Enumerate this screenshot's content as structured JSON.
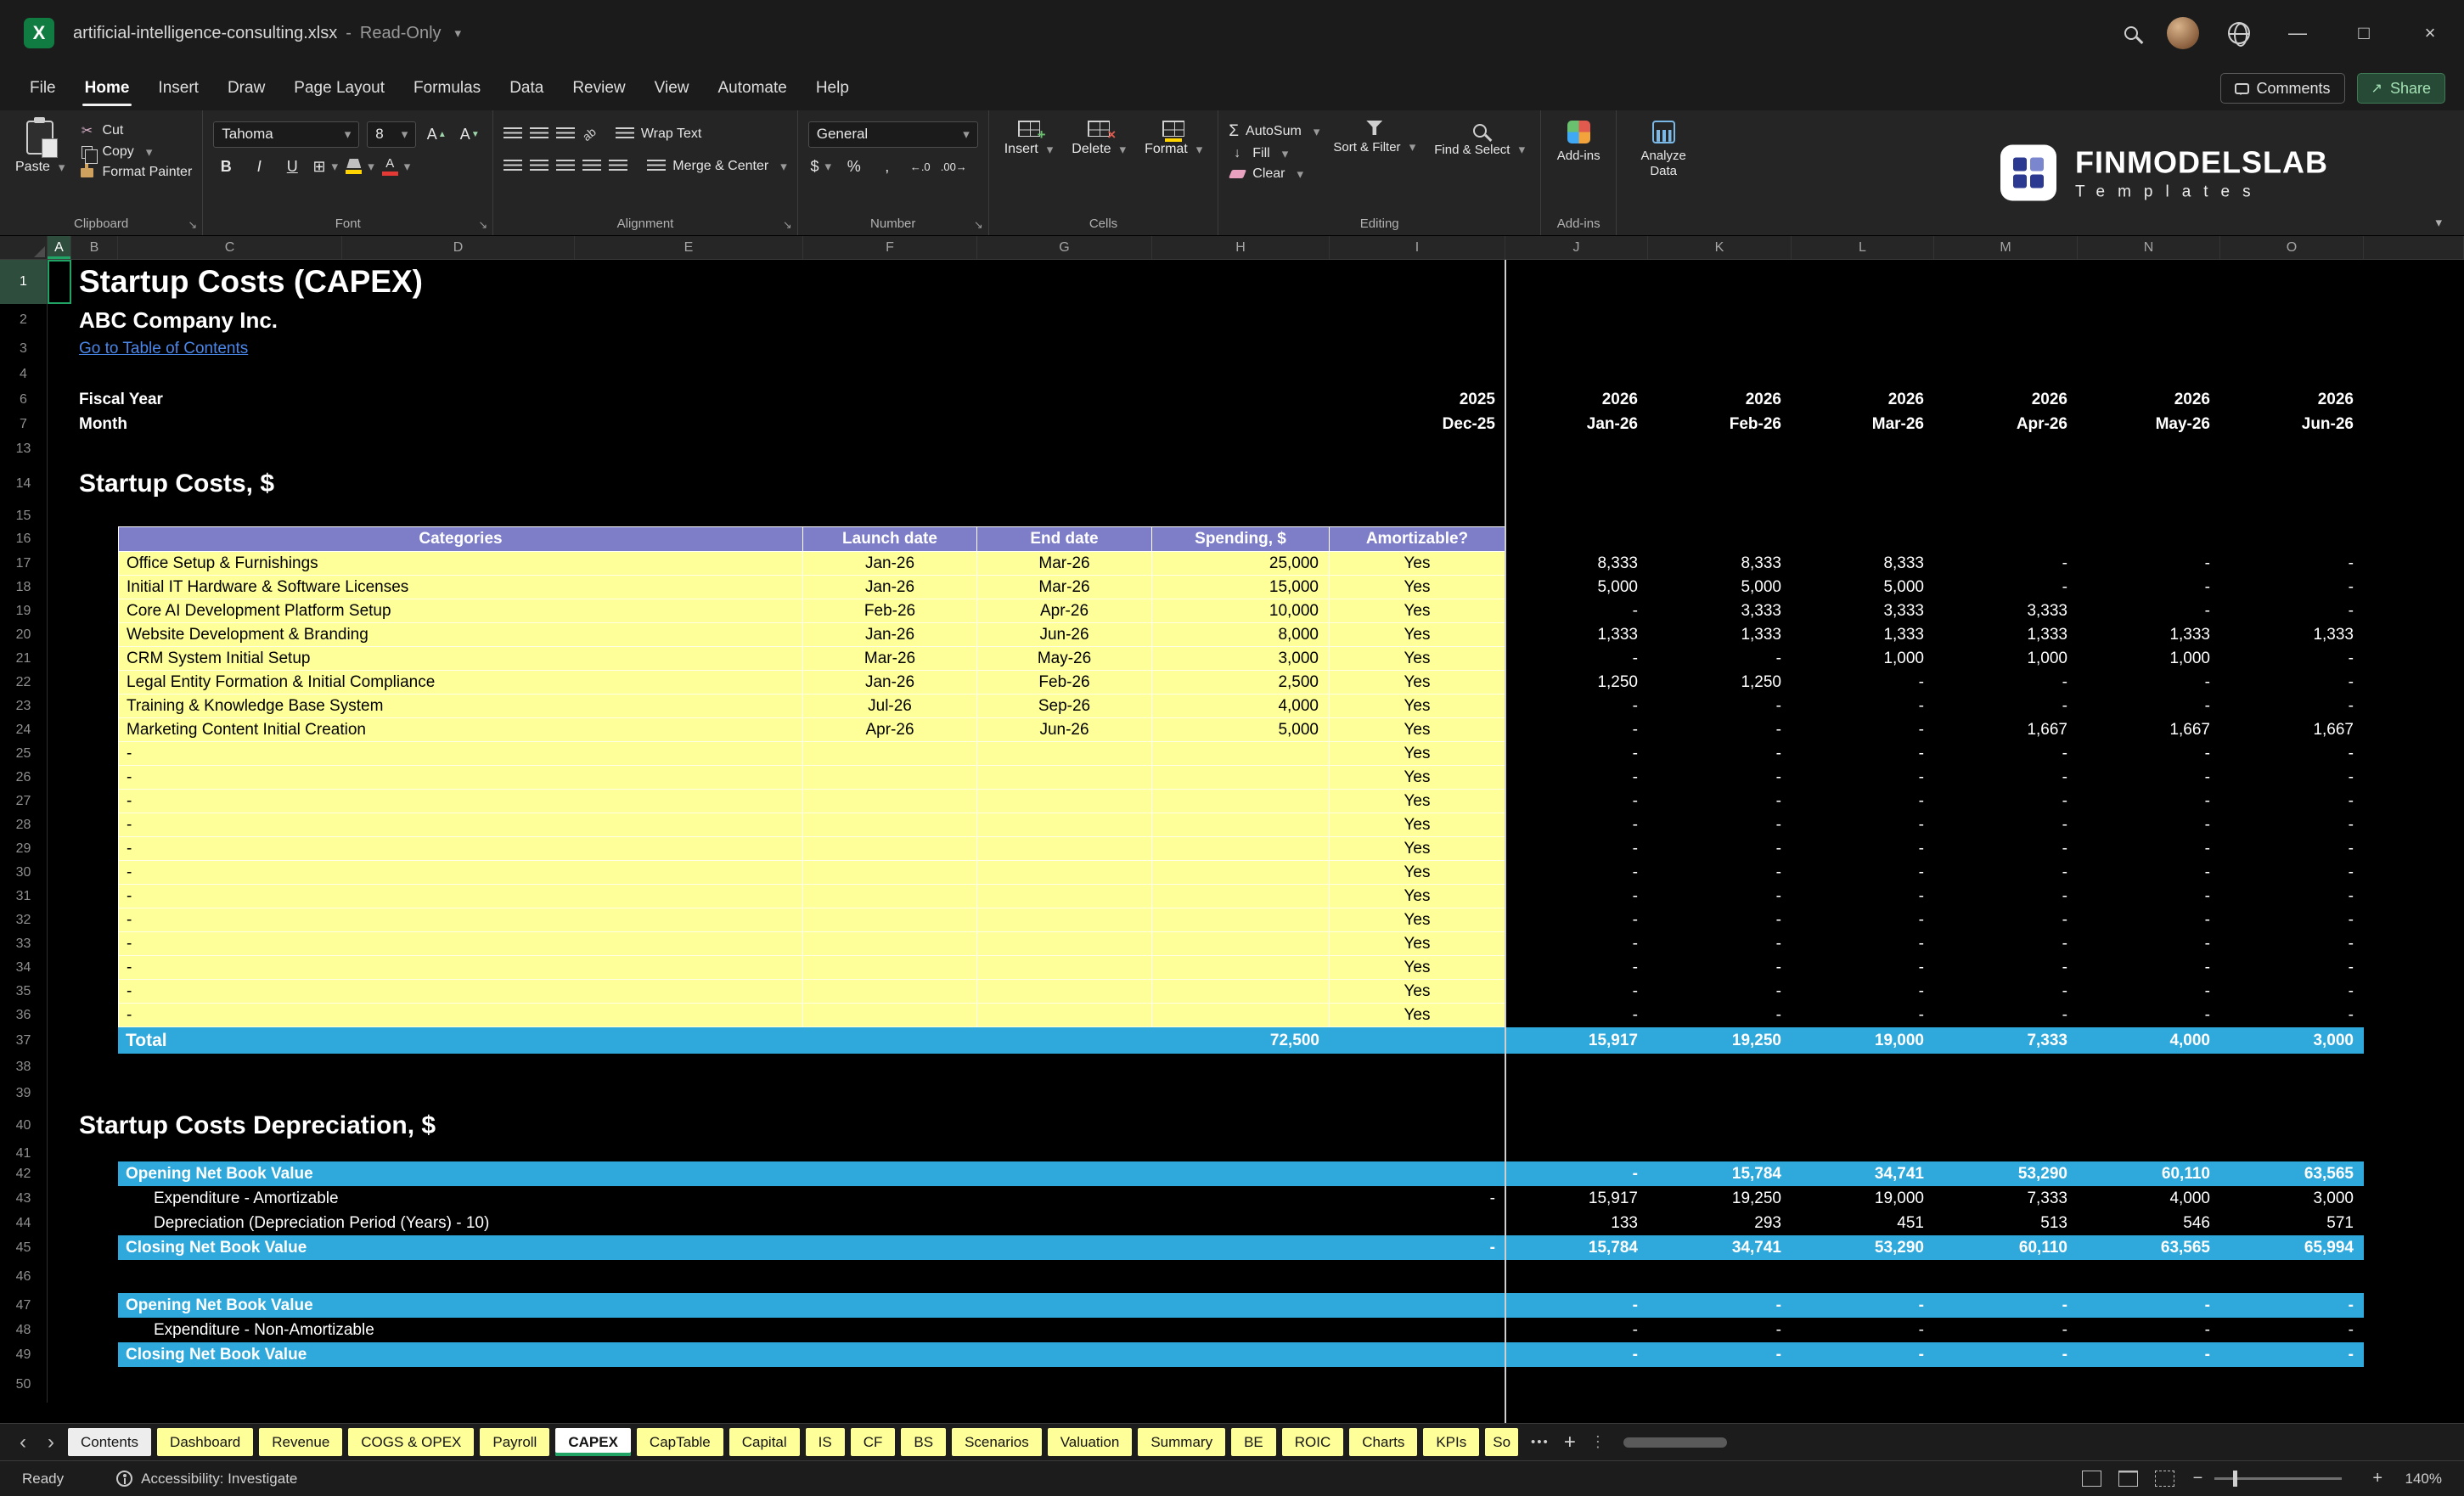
{
  "window": {
    "file_name": "artificial-intelligence-consulting.xlsx",
    "separator": "-",
    "mode": "Read-Only"
  },
  "menu": {
    "items": [
      "File",
      "Home",
      "Insert",
      "Draw",
      "Page Layout",
      "Formulas",
      "Data",
      "Review",
      "View",
      "Automate",
      "Help"
    ],
    "active": "Home",
    "comments": "Comments",
    "share": "Share"
  },
  "ribbon": {
    "clipboard": {
      "label": "Clipboard",
      "paste": "Paste",
      "cut": "Cut",
      "copy": "Copy",
      "format_painter": "Format Painter"
    },
    "font": {
      "label": "Font",
      "font_name": "Tahoma",
      "font_size": "8",
      "bold": "B",
      "italic": "I",
      "underline": "U"
    },
    "alignment": {
      "label": "Alignment",
      "wrap_text": "Wrap Text",
      "merge_center": "Merge & Center"
    },
    "number": {
      "label": "Number",
      "format": "General",
      "currency": "$",
      "percent": "%",
      "comma": ","
    },
    "cells": {
      "label": "Cells",
      "insert": "Insert",
      "delete": "Delete",
      "format": "Format"
    },
    "editing": {
      "label": "Editing",
      "autosum": "AutoSum",
      "fill": "Fill",
      "clear": "Clear",
      "sort_filter": "Sort & Filter",
      "find_select": "Find & Select"
    },
    "addins": {
      "label": "Add-ins",
      "button": "Add-ins",
      "analyze": "Analyze Data"
    }
  },
  "brand": {
    "name": "FINMODELSLAB",
    "tagline": "Templates"
  },
  "colors": {
    "input_yellow": "#FFFF99",
    "header_purple": "#7D7DC8",
    "band_blue": "#2FA8DC",
    "active_green": "#21A366",
    "link_blue": "#4A86E8"
  },
  "sheet": {
    "columns": [
      "A",
      "B",
      "C",
      "D",
      "E",
      "F",
      "G",
      "H",
      "I",
      "J",
      "K",
      "L",
      "M",
      "N",
      "O"
    ],
    "row_numbers": [
      1,
      2,
      3,
      4,
      6,
      7,
      13,
      14,
      15,
      16,
      17,
      18,
      19,
      20,
      21,
      22,
      23,
      24,
      25,
      26,
      27,
      28,
      29,
      30,
      31,
      32,
      33,
      34,
      35,
      36,
      37,
      38,
      39,
      40,
      41,
      42,
      43,
      44,
      45,
      46,
      47,
      48,
      49,
      50
    ],
    "title": "Startup Costs (CAPEX)",
    "company": "ABC Company Inc.",
    "toc_link": "Go to Table of Contents",
    "fiscal_year_label": "Fiscal Year",
    "fiscal_year_first": "2025",
    "fiscal_years": [
      "2026",
      "2026",
      "2026",
      "2026",
      "2026",
      "2026"
    ],
    "month_label": "Month",
    "month_first": "Dec-25",
    "months": [
      "Jan-26",
      "Feb-26",
      "Mar-26",
      "Apr-26",
      "May-26",
      "Jun-26"
    ],
    "section_costs": "Startup Costs, $",
    "section_depreciation": "Startup Costs Depreciation, $",
    "table": {
      "headers": [
        "Categories",
        "Launch date",
        "End date",
        "Spending, $",
        "Amortizable?"
      ],
      "rows": [
        {
          "category": "Office Setup & Furnishings",
          "launch": "Jan-26",
          "end": "Mar-26",
          "spending": "25,000",
          "amortizable": "Yes",
          "values": [
            "8,333",
            "8,333",
            "8,333",
            "-",
            "-",
            "-"
          ]
        },
        {
          "category": "Initial IT Hardware & Software Licenses",
          "launch": "Jan-26",
          "end": "Mar-26",
          "spending": "15,000",
          "amortizable": "Yes",
          "values": [
            "5,000",
            "5,000",
            "5,000",
            "-",
            "-",
            "-"
          ]
        },
        {
          "category": "Core AI Development Platform Setup",
          "launch": "Feb-26",
          "end": "Apr-26",
          "spending": "10,000",
          "amortizable": "Yes",
          "values": [
            "-",
            "3,333",
            "3,333",
            "3,333",
            "-",
            "-"
          ]
        },
        {
          "category": "Website Development & Branding",
          "launch": "Jan-26",
          "end": "Jun-26",
          "spending": "8,000",
          "amortizable": "Yes",
          "values": [
            "1,333",
            "1,333",
            "1,333",
            "1,333",
            "1,333",
            "1,333"
          ]
        },
        {
          "category": "CRM System Initial Setup",
          "launch": "Mar-26",
          "end": "May-26",
          "spending": "3,000",
          "amortizable": "Yes",
          "values": [
            "-",
            "-",
            "1,000",
            "1,000",
            "1,000",
            "-"
          ]
        },
        {
          "category": "Legal Entity Formation & Initial Compliance",
          "launch": "Jan-26",
          "end": "Feb-26",
          "spending": "2,500",
          "amortizable": "Yes",
          "values": [
            "1,250",
            "1,250",
            "-",
            "-",
            "-",
            "-"
          ]
        },
        {
          "category": "Training & Knowledge Base System",
          "launch": "Jul-26",
          "end": "Sep-26",
          "spending": "4,000",
          "amortizable": "Yes",
          "values": [
            "-",
            "-",
            "-",
            "-",
            "-",
            "-"
          ]
        },
        {
          "category": "Marketing Content Initial Creation",
          "launch": "Apr-26",
          "end": "Jun-26",
          "spending": "5,000",
          "amortizable": "Yes",
          "values": [
            "-",
            "-",
            "-",
            "1,667",
            "1,667",
            "1,667"
          ]
        },
        {
          "category": "-",
          "launch": "",
          "end": "",
          "spending": "",
          "amortizable": "Yes",
          "values": [
            "-",
            "-",
            "-",
            "-",
            "-",
            "-"
          ]
        },
        {
          "category": "-",
          "launch": "",
          "end": "",
          "spending": "",
          "amortizable": "Yes",
          "values": [
            "-",
            "-",
            "-",
            "-",
            "-",
            "-"
          ]
        },
        {
          "category": "-",
          "launch": "",
          "end": "",
          "spending": "",
          "amortizable": "Yes",
          "values": [
            "-",
            "-",
            "-",
            "-",
            "-",
            "-"
          ]
        },
        {
          "category": "-",
          "launch": "",
          "end": "",
          "spending": "",
          "amortizable": "Yes",
          "values": [
            "-",
            "-",
            "-",
            "-",
            "-",
            "-"
          ]
        },
        {
          "category": "-",
          "launch": "",
          "end": "",
          "spending": "",
          "amortizable": "Yes",
          "values": [
            "-",
            "-",
            "-",
            "-",
            "-",
            "-"
          ]
        },
        {
          "category": "-",
          "launch": "",
          "end": "",
          "spending": "",
          "amortizable": "Yes",
          "values": [
            "-",
            "-",
            "-",
            "-",
            "-",
            "-"
          ]
        },
        {
          "category": "-",
          "launch": "",
          "end": "",
          "spending": "",
          "amortizable": "Yes",
          "values": [
            "-",
            "-",
            "-",
            "-",
            "-",
            "-"
          ]
        },
        {
          "category": "-",
          "launch": "",
          "end": "",
          "spending": "",
          "amortizable": "Yes",
          "values": [
            "-",
            "-",
            "-",
            "-",
            "-",
            "-"
          ]
        },
        {
          "category": "-",
          "launch": "",
          "end": "",
          "spending": "",
          "amortizable": "Yes",
          "values": [
            "-",
            "-",
            "-",
            "-",
            "-",
            "-"
          ]
        },
        {
          "category": "-",
          "launch": "",
          "end": "",
          "spending": "",
          "amortizable": "Yes",
          "values": [
            "-",
            "-",
            "-",
            "-",
            "-",
            "-"
          ]
        },
        {
          "category": "-",
          "launch": "",
          "end": "",
          "spending": "",
          "amortizable": "Yes",
          "values": [
            "-",
            "-",
            "-",
            "-",
            "-",
            "-"
          ]
        },
        {
          "category": "-",
          "launch": "",
          "end": "",
          "spending": "",
          "amortizable": "Yes",
          "values": [
            "-",
            "-",
            "-",
            "-",
            "-",
            "-"
          ]
        }
      ],
      "total_label": "Total",
      "total_spending": "72,500",
      "total_values": [
        "15,917",
        "19,250",
        "19,000",
        "7,333",
        "4,000",
        "3,000"
      ]
    },
    "depreciation_rows": [
      {
        "style": "band",
        "label": "Opening Net Book Value",
        "col_i": "",
        "values": [
          "-",
          "15,784",
          "34,741",
          "53,290",
          "60,110",
          "63,565"
        ]
      },
      {
        "style": "plain",
        "label": "Expenditure - Amortizable",
        "col_i": "-",
        "values": [
          "15,917",
          "19,250",
          "19,000",
          "7,333",
          "4,000",
          "3,000"
        ]
      },
      {
        "style": "plain",
        "label": "Depreciation (Depreciation Period (Years) - 10)",
        "col_i": "",
        "values": [
          "133",
          "293",
          "451",
          "513",
          "546",
          "571"
        ]
      },
      {
        "style": "band",
        "label": "Closing Net Book Value",
        "col_i": "-",
        "values": [
          "15,784",
          "34,741",
          "53,290",
          "60,110",
          "63,565",
          "65,994"
        ]
      }
    ],
    "non_amortizable_rows": [
      {
        "style": "band",
        "label": "Opening Net Book Value",
        "col_i": "",
        "values": [
          "-",
          "-",
          "-",
          "-",
          "-",
          "-"
        ]
      },
      {
        "style": "plain",
        "label": "Expenditure - Non-Amortizable",
        "col_i": "",
        "values": [
          "-",
          "-",
          "-",
          "-",
          "-",
          "-"
        ]
      },
      {
        "style": "band",
        "label": "Closing Net Book Value",
        "col_i": "",
        "values": [
          "-",
          "-",
          "-",
          "-",
          "-",
          "-"
        ]
      }
    ]
  },
  "tabs": {
    "items": [
      {
        "label": "Contents",
        "style": "white"
      },
      {
        "label": "Dashboard",
        "style": "yellow"
      },
      {
        "label": "Revenue",
        "style": "yellow"
      },
      {
        "label": "COGS & OPEX",
        "style": "yellow"
      },
      {
        "label": "Payroll",
        "style": "yellow"
      },
      {
        "label": "CAPEX",
        "style": "active"
      },
      {
        "label": "CapTable",
        "style": "yellow"
      },
      {
        "label": "Capital",
        "style": "yellow"
      },
      {
        "label": "IS",
        "style": "yellow"
      },
      {
        "label": "CF",
        "style": "yellow"
      },
      {
        "label": "BS",
        "style": "yellow"
      },
      {
        "label": "Scenarios",
        "style": "yellow"
      },
      {
        "label": "Valuation",
        "style": "yellow"
      },
      {
        "label": "Summary",
        "style": "yellow"
      },
      {
        "label": "BE",
        "style": "yellow"
      },
      {
        "label": "ROIC",
        "style": "yellow"
      },
      {
        "label": "Charts",
        "style": "yellow"
      },
      {
        "label": "KPIs",
        "style": "yellow"
      },
      {
        "label": "So",
        "style": "yellow",
        "truncated": true
      }
    ]
  },
  "status": {
    "ready": "Ready",
    "accessibility": "Accessibility: Investigate",
    "zoom": "140%"
  }
}
